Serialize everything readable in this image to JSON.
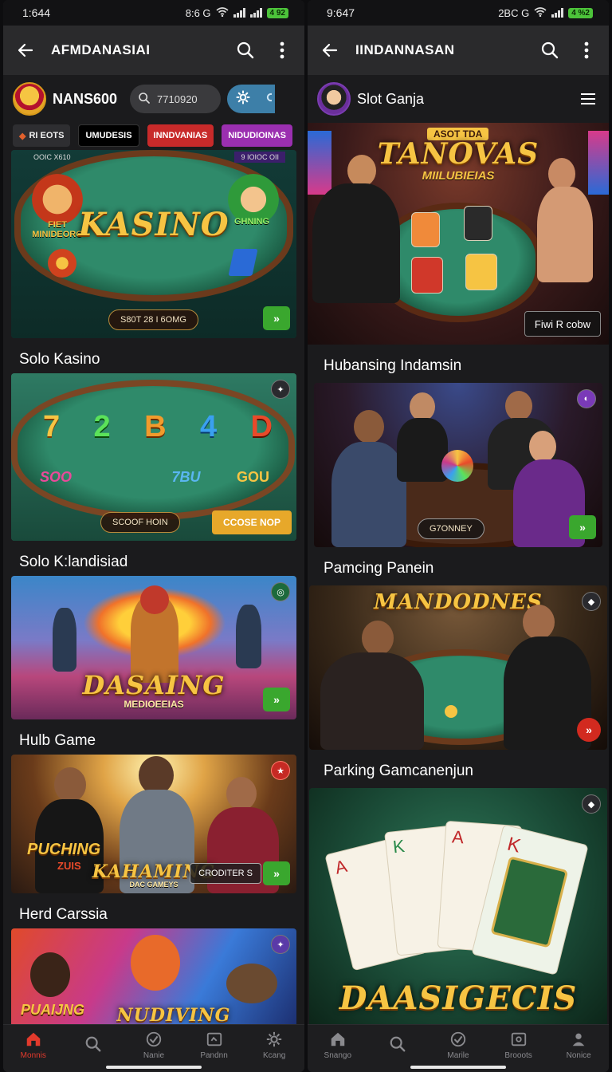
{
  "left": {
    "status": {
      "time": "1:644",
      "icons": "8:6 G",
      "battery": "4 92"
    },
    "appbar": {
      "title": "AFMDANASIAI"
    },
    "brand": {
      "name": "NANS600"
    },
    "search": {
      "value": "7710920"
    },
    "chips": [
      "RI EOTS",
      "UMUDESIS",
      "INNDVANIAS",
      "NIDUDIOINAS"
    ],
    "hero": {
      "corner_left": "OOIC X610",
      "corner_right": "9 IOIOC OII",
      "big": "KASINO",
      "left_label": "FIET MINIDEORG",
      "right_label": "GHNING",
      "pill": "S80T 28 I 6OMG"
    },
    "sections": [
      {
        "title": "Solo Kasino",
        "reels": [
          "7",
          "2",
          "B",
          "4",
          "D"
        ],
        "reel_sub": [
          "SOO",
          "7BU",
          "GOU"
        ],
        "pill": "SCOOF HOIN",
        "cta": "CCOSE NOP"
      },
      {
        "title": "Solo K:landisiad",
        "big": "DASAING",
        "sub": "MEDIOEEIAS"
      },
      {
        "title": "Hulb Game",
        "left_logo": "PUCHING",
        "left_logo_sub": "ZUIS",
        "big": "KAHAMING",
        "sub": "DAC GAMEYS",
        "pill": "CRODITER S"
      },
      {
        "title": "Herd Carssia",
        "big": "NUDIVING",
        "left_logo": "PUAIJNG"
      }
    ],
    "nav": [
      {
        "label": "Monnis",
        "icon": "home-icon",
        "active": true
      },
      {
        "label": "",
        "icon": "search-icon",
        "active": false
      },
      {
        "label": "Nanie",
        "icon": "check-circle-icon",
        "active": false
      },
      {
        "label": "Pandnn",
        "icon": "ticket-icon",
        "active": false
      },
      {
        "label": "Kcang",
        "icon": "gear-icon",
        "active": false
      }
    ]
  },
  "right": {
    "status": {
      "time": "9:647",
      "icons": "2BC G",
      "battery": "4 %2"
    },
    "appbar": {
      "title": "IINDANNASAN"
    },
    "brand": {
      "name": "Slot Ganja"
    },
    "hero": {
      "top": "ASOT TDA",
      "big": "TANOVAS",
      "sub": "MIILUBIEIAS",
      "pill": "Fiwi R cobw"
    },
    "sections": [
      {
        "title": "Hubansing Indamsin",
        "pill": "G7ONNEY"
      },
      {
        "title": "Pamcing Panein",
        "big": "MANDODNES"
      },
      {
        "title": "Parking Gamcanenjun",
        "big": "DAASIGECIS"
      }
    ],
    "nav": [
      {
        "label": "Snango",
        "icon": "home-icon"
      },
      {
        "label": "",
        "icon": "search-icon"
      },
      {
        "label": "Marile",
        "icon": "check-circle-icon"
      },
      {
        "label": "Brooots",
        "icon": "ticket-icon"
      },
      {
        "label": "Nonice",
        "icon": "user-icon"
      }
    ]
  },
  "colors": {
    "accent_red": "#e23a2c",
    "go_green": "#3aa72e",
    "gold": "#f6c443"
  }
}
